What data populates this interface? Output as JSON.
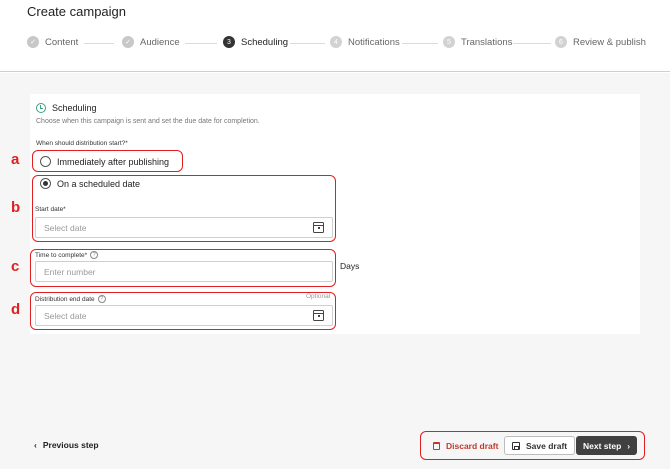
{
  "page_title": "Create campaign",
  "steps": [
    {
      "label": "Content",
      "badge": "✓",
      "state": "done"
    },
    {
      "label": "Audience",
      "badge": "✓",
      "state": "done"
    },
    {
      "label": "Scheduling",
      "badge": "3",
      "state": "active"
    },
    {
      "label": "Notifications",
      "badge": "4",
      "state": "upcoming"
    },
    {
      "label": "Translations",
      "badge": "5",
      "state": "upcoming"
    },
    {
      "label": "Review & publish",
      "badge": "6",
      "state": "upcoming"
    }
  ],
  "section": {
    "title": "Scheduling",
    "description": "Choose when this campaign is sent and set the due date for completion.",
    "icon": "clock-icon"
  },
  "question": "When should distribution start?*",
  "options": {
    "immediate": "Immediately after publishing",
    "scheduled": "On a scheduled date",
    "selected": "scheduled"
  },
  "start_date": {
    "label": "Start date*",
    "placeholder": "Select date"
  },
  "time_to_complete": {
    "label": "Time to complete*",
    "placeholder": "Enter number",
    "unit": "Days"
  },
  "end_date": {
    "label": "Distribution end date",
    "optional": "Optional",
    "placeholder": "Select date"
  },
  "annotations": {
    "a": "a",
    "b": "b",
    "c": "c",
    "d": "d",
    "color": "#e02020"
  },
  "footer": {
    "prev_label": "Previous step",
    "prev_icon": "‹",
    "discard_label": "Discard draft",
    "save_label": "Save draft",
    "next_label": "Next step",
    "next_icon": "›"
  },
  "colors": {
    "accent_dark": "#404040",
    "danger": "#c0392b",
    "success": "#3aa37a"
  }
}
